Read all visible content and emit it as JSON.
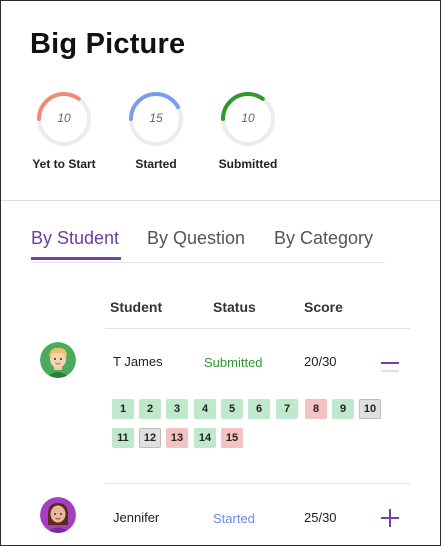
{
  "title": "Big Picture",
  "stats": [
    {
      "label": "Yet to Start",
      "count": "10",
      "color": "#f08a7a",
      "fraction": 0.35
    },
    {
      "label": "Started",
      "count": "15",
      "color": "#7a9cf0",
      "fraction": 0.42
    },
    {
      "label": "Submitted",
      "count": "10",
      "color": "#2e9a2e",
      "fraction": 0.35
    }
  ],
  "tabs": [
    {
      "label": "By Student",
      "active": true
    },
    {
      "label": "By Question",
      "active": false
    },
    {
      "label": "By Category",
      "active": false
    }
  ],
  "table": {
    "headers": {
      "student": "Student",
      "status": "Status",
      "score": "Score"
    }
  },
  "students": [
    {
      "name": "T James",
      "status": "Submitted",
      "score": "20/30",
      "expanded": true,
      "toggle_icon": "minus-icon",
      "questions": [
        {
          "n": "1",
          "state": "correct"
        },
        {
          "n": "2",
          "state": "correct"
        },
        {
          "n": "3",
          "state": "correct"
        },
        {
          "n": "4",
          "state": "correct"
        },
        {
          "n": "5",
          "state": "correct"
        },
        {
          "n": "6",
          "state": "correct"
        },
        {
          "n": "7",
          "state": "correct"
        },
        {
          "n": "8",
          "state": "incorrect"
        },
        {
          "n": "9",
          "state": "correct"
        },
        {
          "n": "10",
          "state": "unanswered"
        },
        {
          "n": "11",
          "state": "correct"
        },
        {
          "n": "12",
          "state": "unanswered"
        },
        {
          "n": "13",
          "state": "incorrect"
        },
        {
          "n": "14",
          "state": "correct"
        },
        {
          "n": "15",
          "state": "incorrect"
        }
      ]
    },
    {
      "name": "Jennifer",
      "status": "Started",
      "score": "25/30",
      "expanded": false,
      "toggle_icon": "plus-icon"
    }
  ],
  "colors": {
    "accent": "#7040b0",
    "correct": "#bfe8cd",
    "incorrect": "#f4c2c2",
    "unanswered": "#e0e0e0"
  }
}
